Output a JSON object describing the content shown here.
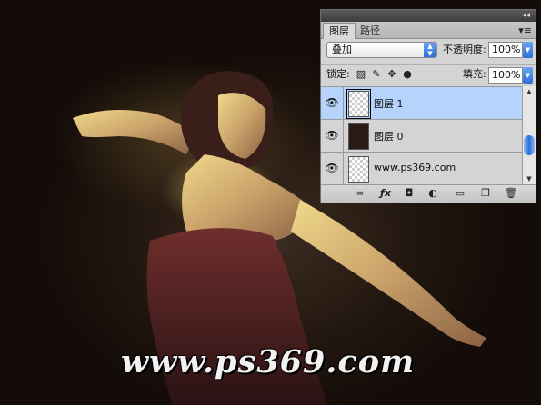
{
  "panel": {
    "tabs": [
      {
        "label": "图层"
      },
      {
        "label": "路径"
      }
    ],
    "menu_icon": "panel-menu-icon",
    "blend_mode": "叠加",
    "opacity_label": "不透明度:",
    "opacity_value": "100%",
    "lock_label": "锁定:",
    "fill_label": "填充:",
    "fill_value": "100%",
    "layers": [
      {
        "name": "图层 1",
        "selected": true
      },
      {
        "name": "图层 0",
        "selected": false
      },
      {
        "name": "www.ps369.com",
        "selected": false
      }
    ],
    "footer_icons": [
      "link-layers-icon",
      "fx-icon",
      "add-mask-icon",
      "adjustment-layer-icon",
      "new-group-icon",
      "new-layer-icon",
      "trash-icon"
    ]
  },
  "watermark": "www.ps369.com",
  "colors": {
    "selected_layer": "#b6d3fb",
    "panel_bg": "#d4d4d4",
    "accent_blue": "#2d6fd8"
  }
}
